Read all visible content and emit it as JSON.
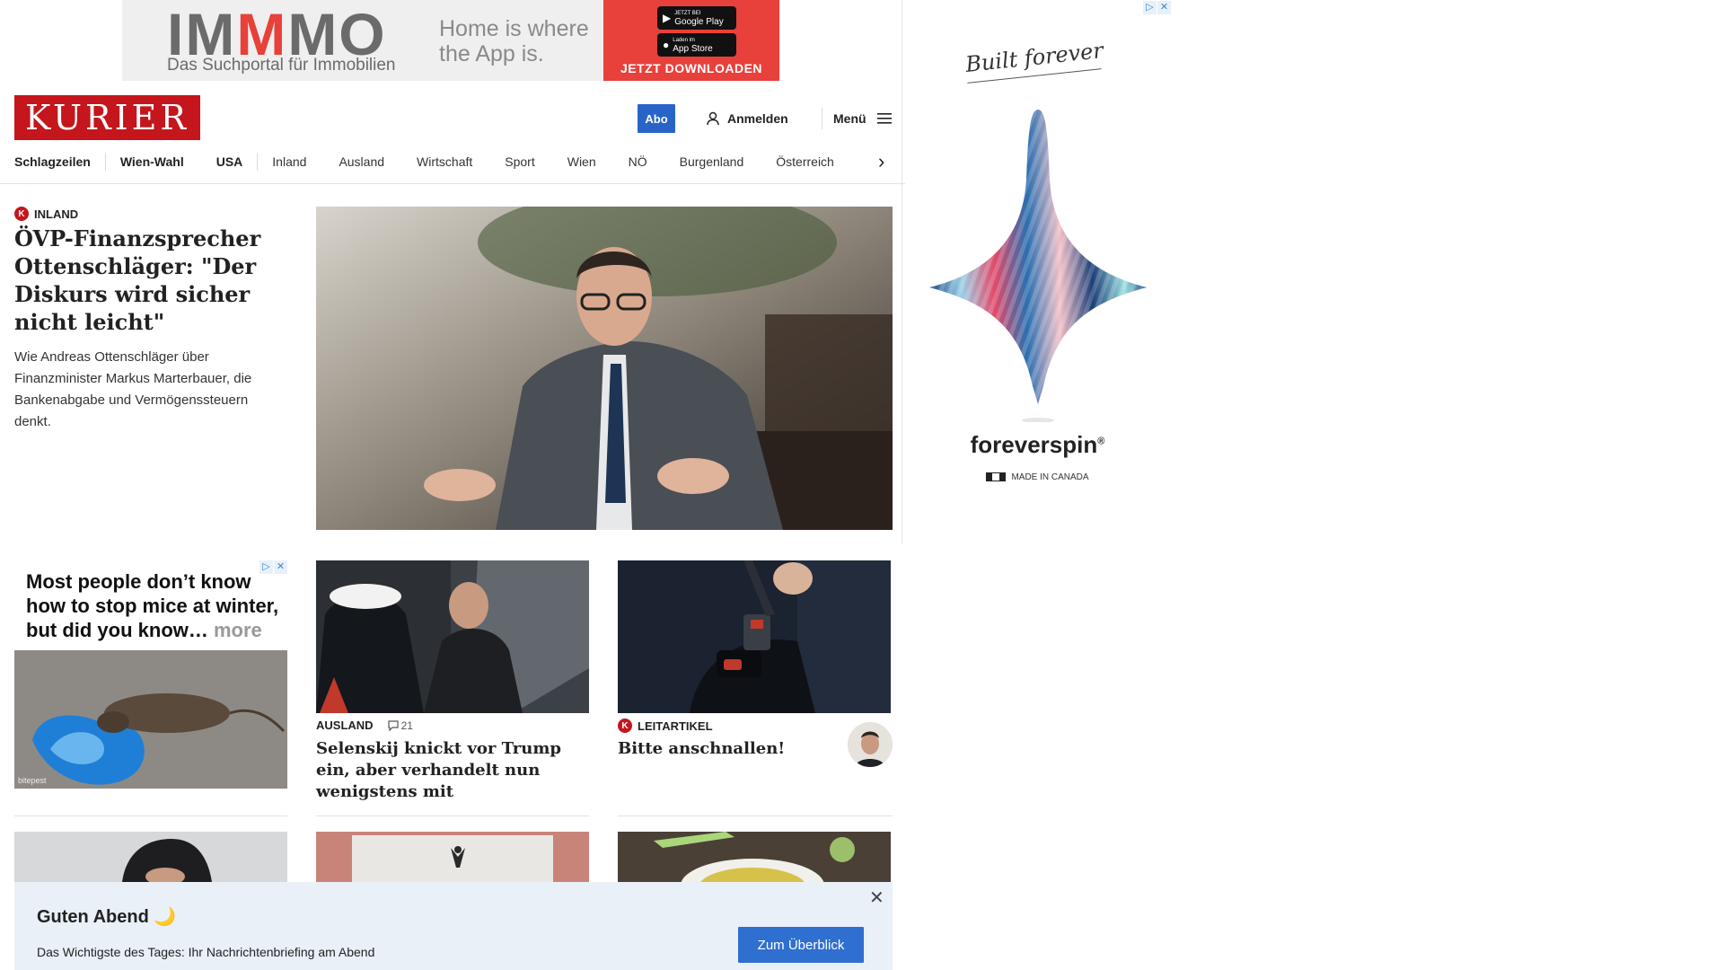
{
  "top_ad": {
    "brand_a": "IM",
    "brand_b": "M",
    "brand_c": "MO",
    "tagline": "Das Suchportal für Immobilien",
    "slogan": "Home is where the App is.",
    "google_play_small": "JETZT BEI",
    "google_play": "Google Play",
    "app_store_small": "Laden im",
    "app_store": "App Store",
    "cta": "JETZT DOWNLOADEN"
  },
  "side_ad": {
    "script_text": "Built forever",
    "brand": "foreverspin",
    "registered": "®",
    "made_in": "MADE IN CANADA"
  },
  "header": {
    "logo": "KURIER",
    "abo": "Abo",
    "login": "Anmelden",
    "menu": "Menü"
  },
  "nav": {
    "items": [
      "Schlagzeilen",
      "Wien-Wahl",
      "USA",
      "Inland",
      "Ausland",
      "Wirtschaft",
      "Sport",
      "Wien",
      "NÖ",
      "Burgenland",
      "Österreich"
    ]
  },
  "lead": {
    "kicker": "INLAND",
    "title": "ÖVP-Finanzsprecher Ottenschläger: \"Der Diskurs wird sicher nicht leicht\"",
    "teaser": "Wie Andreas Ottenschläger über Finanzminister Markus Marterbauer, die Bankenabgabe und Vermögenssteuern denkt."
  },
  "mice_ad": {
    "text": "Most people don’t know how to stop mice at winter, but did you know…",
    "more": "more",
    "credit": "bitepest"
  },
  "cards": [
    {
      "kicker": "AUSLAND",
      "comments": "21",
      "title": "Selenskij knickt vor Trump ein, aber verhandelt nun wenigstens mit"
    },
    {
      "kicker": "LEITARTIKEL",
      "title": "Bitte anschnallen!"
    }
  ],
  "notification": {
    "title": "Guten Abend",
    "emoji": "🌙",
    "text": "Das Wichtigste des Tages: Ihr Nachrichtenbriefing am Abend",
    "button": "Zum Überblick",
    "close": "✕"
  },
  "colors": {
    "brand_red": "#c4161c",
    "abo_blue": "#2864c8",
    "notify_bg": "#e9f0f8",
    "immmo_red": "#e8403a"
  }
}
